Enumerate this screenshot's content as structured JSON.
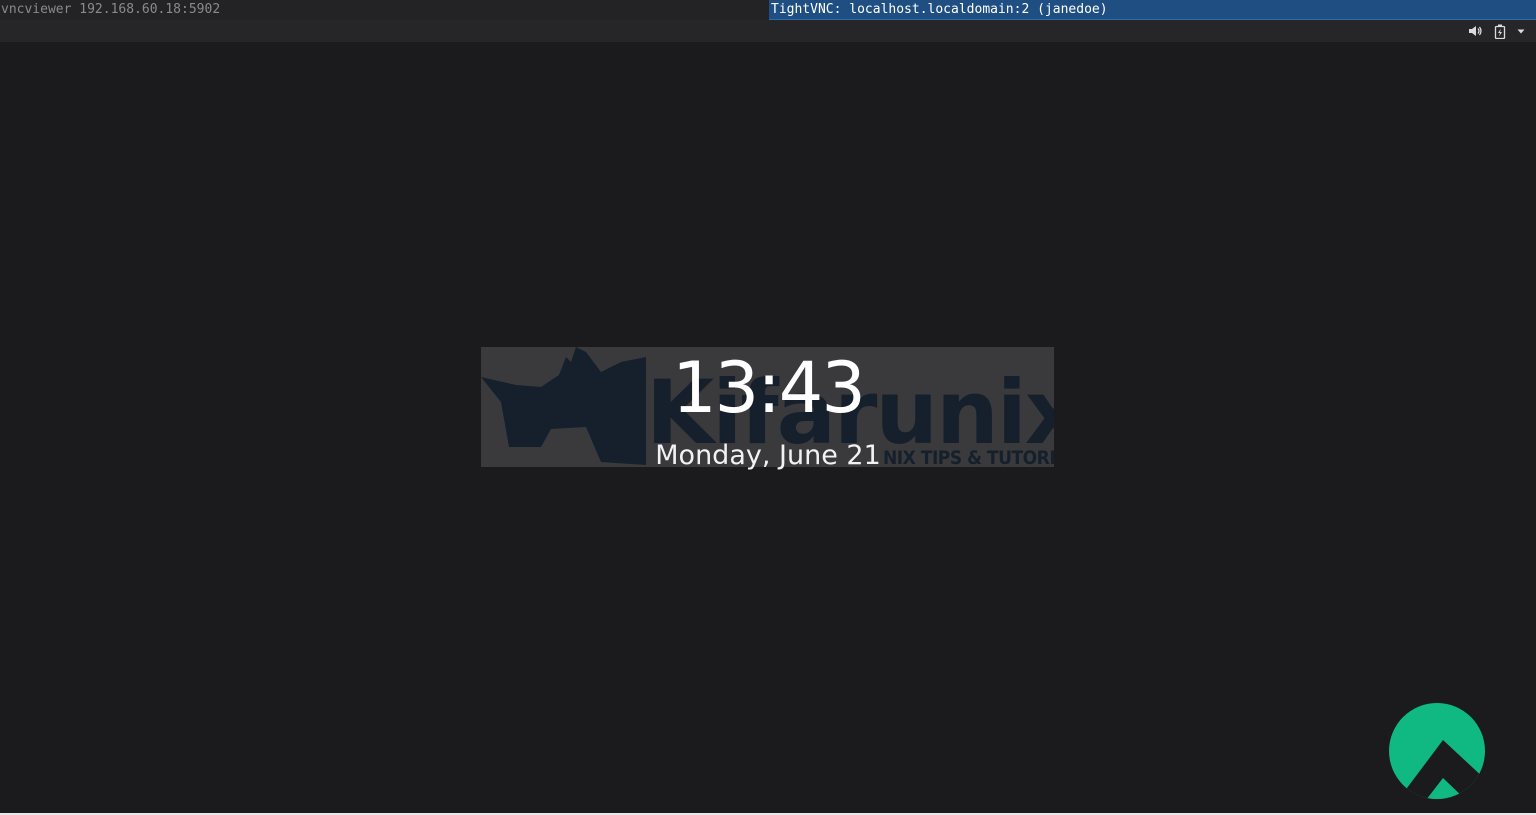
{
  "window": {
    "command_title": "vncviewer 192.168.60.18:5902",
    "vnc_title": "TightVNC: localhost.localdomain:2 (janedoe)"
  },
  "status_area": {
    "icons": [
      "volume-icon",
      "battery-icon",
      "dropdown-arrow-icon"
    ]
  },
  "lock_screen": {
    "time": "13:43",
    "date": "Monday, June 21"
  },
  "wallpaper": {
    "logo_text": "Kifarunix",
    "tagline": "NIX TIPS & TUTORIALS"
  },
  "colors": {
    "background": "#1b1b1d",
    "title_highlight": "#1f4f82",
    "distro_logo": "#10b981"
  }
}
